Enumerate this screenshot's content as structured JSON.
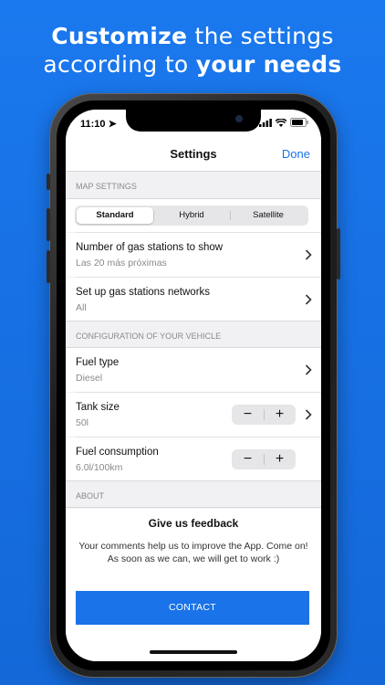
{
  "headline": {
    "line1_bold": "Customize",
    "line1_rest": " the settings",
    "line2_start": "according to ",
    "line2_bold": "your needs"
  },
  "status": {
    "time": "11:10"
  },
  "nav": {
    "title": "Settings",
    "done": "Done"
  },
  "map_settings": {
    "header": "MAP SETTINGS",
    "segments": [
      "Standard",
      "Hybrid",
      "Satellite"
    ],
    "selected": "Standard",
    "rows": [
      {
        "label": "Number of gas stations to show",
        "value": "Las 20 más próximas"
      },
      {
        "label": "Set up gas stations networks",
        "value": "All"
      }
    ]
  },
  "vehicle": {
    "header": "CONFIGURATION OF YOUR VEHICLE",
    "fuel_type": {
      "label": "Fuel type",
      "value": "Diesel"
    },
    "tank_size": {
      "label": "Tank size",
      "value": "50l"
    },
    "fuel_consumption": {
      "label": "Fuel consumption",
      "value": "6.0l/100km"
    },
    "minus": "−",
    "plus": "+"
  },
  "about": {
    "header": "ABOUT",
    "feedback_title": "Give us feedback",
    "feedback_body": "Your comments help us to improve the App. Come on! As soon as we can, we will get to work :)",
    "contact_label": "CONTACT"
  },
  "colors": {
    "accent": "#1a73e8",
    "background": "#1a78ee"
  }
}
